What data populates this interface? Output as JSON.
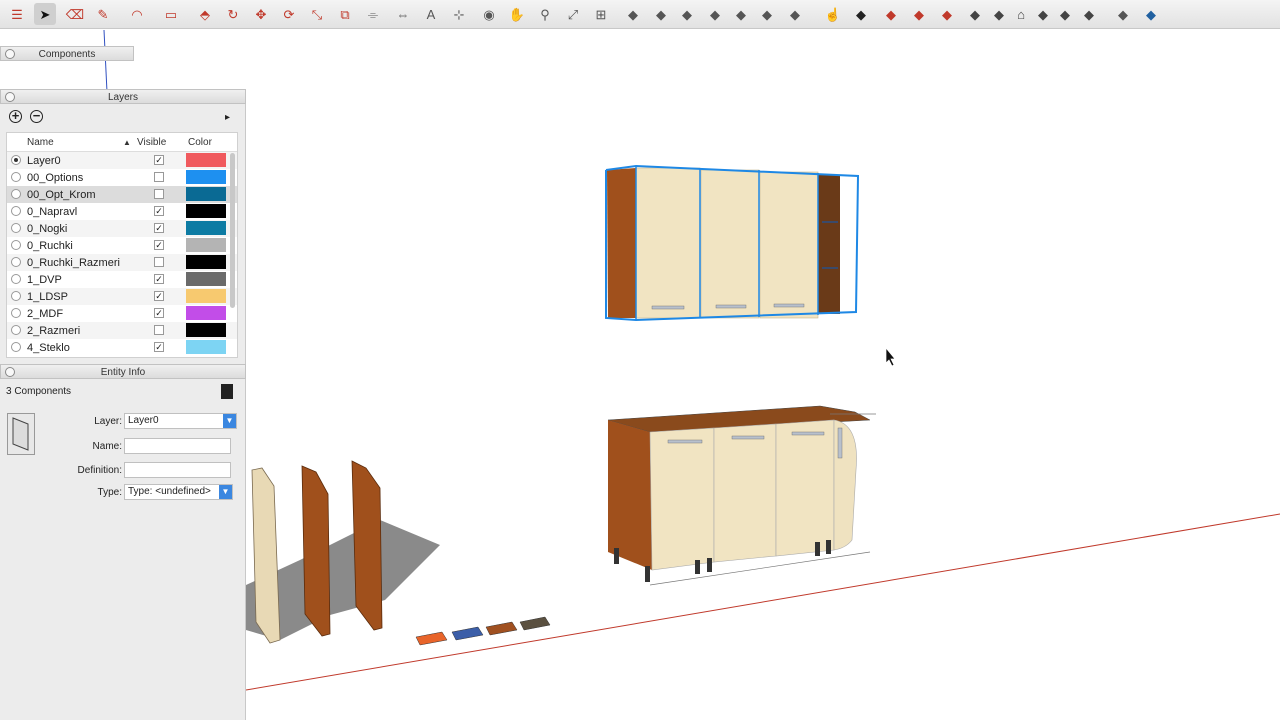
{
  "colors": {
    "accent": "#3b87e0",
    "selection": "#1e88e5",
    "axis_red": "#c0392b"
  },
  "toolbar": {
    "icons": [
      "sketchup-logo-icon",
      "select-arrow-icon",
      "eraser-icon",
      "line-pencil-icon",
      "arc-icon",
      "rectangle-icon",
      "push-pull-icon",
      "follow-me-icon",
      "move-icon",
      "rotate-icon",
      "scale-icon",
      "offset-icon",
      "tape-measure-icon",
      "dimension-icon",
      "text-icon",
      "axes-icon",
      "orbit-icon",
      "pan-icon",
      "zoom-icon",
      "zoom-extents-icon",
      "section-plane-icon",
      "view-iso-icon",
      "view-top-icon",
      "view-front-icon",
      "view-right-icon",
      "view-back-icon",
      "view-left-icon",
      "view-bottom-icon",
      "hand-cursor-icon",
      "warehouse-icon",
      "ruby-icon",
      "extension-icon",
      "extension-2-icon",
      "style-1-icon",
      "style-2-icon",
      "house-icon",
      "style-3-icon",
      "style-4-icon",
      "style-5-icon",
      "display-1-icon",
      "display-2-icon"
    ]
  },
  "components_panel": {
    "title": "Components"
  },
  "layers_panel": {
    "title": "Layers",
    "columns": {
      "name": "Name",
      "visible": "Visible",
      "color": "Color"
    },
    "rows": [
      {
        "name": "Layer0",
        "active": true,
        "visible": true,
        "color": "#f05a5e"
      },
      {
        "name": "00_Options",
        "active": false,
        "visible": false,
        "color": "#1e90f0"
      },
      {
        "name": "00_Opt_Krom",
        "active": false,
        "visible": false,
        "color": "#0a6a94"
      },
      {
        "name": "0_Napravl",
        "active": false,
        "visible": true,
        "color": "#000000"
      },
      {
        "name": "0_Nogki",
        "active": false,
        "visible": true,
        "color": "#0d7ba3"
      },
      {
        "name": "0_Ruchki",
        "active": false,
        "visible": true,
        "color": "#b4b4b4"
      },
      {
        "name": "0_Ruchki_Razmeri",
        "active": false,
        "visible": false,
        "color": "#000000"
      },
      {
        "name": "1_DVP",
        "active": false,
        "visible": true,
        "color": "#6a6a6a"
      },
      {
        "name": "1_LDSP",
        "active": false,
        "visible": true,
        "color": "#f7c96f"
      },
      {
        "name": "2_MDF",
        "active": false,
        "visible": true,
        "color": "#c24de8"
      },
      {
        "name": "2_Razmeri",
        "active": false,
        "visible": false,
        "color": "#000000"
      },
      {
        "name": "4_Steklo",
        "active": false,
        "visible": true,
        "color": "#7dd4f3"
      }
    ]
  },
  "entity_info": {
    "title": "Entity Info",
    "summary": "3 Components",
    "layer_label": "Layer:",
    "layer_value": "Layer0",
    "name_label": "Name:",
    "name_value": "",
    "definition_label": "Definition:",
    "definition_value": "",
    "type_label": "Type:",
    "type_value": "Type: <undefined>"
  }
}
